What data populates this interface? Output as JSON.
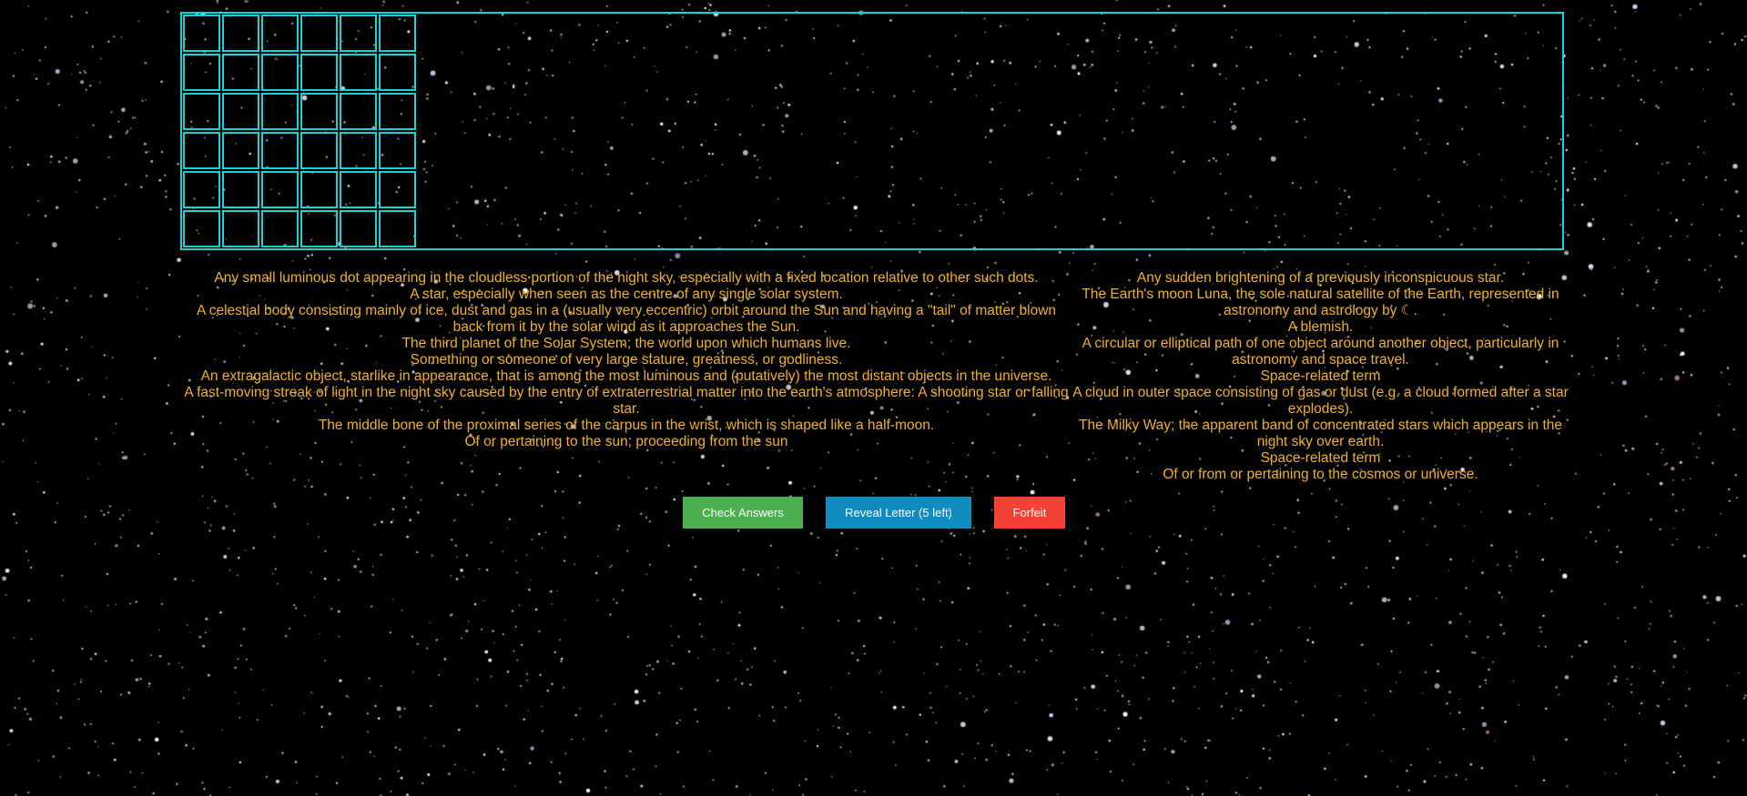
{
  "colors": {
    "background": "#000000",
    "grid_border": "#17d3d3",
    "clue_text": "#f0b020",
    "check_button": "#4caf50",
    "reveal_button": "#0f8bbf",
    "forfeit_button": "#f44336"
  },
  "grid": {
    "rows": 6,
    "cols": 6
  },
  "clues_left": [
    "Any small luminous dot appearing in the cloudless portion of the night sky, especially with a fixed location relative to other such dots.",
    "A star, especially when seen as the centre of any single solar system.",
    "A celestial body consisting mainly of ice, dust and gas in a (usually very eccentric) orbit around the Sun and having a \"tail\" of matter blown back from it by the solar wind as it approaches the Sun.",
    "The third planet of the Solar System; the world upon which humans live.",
    "Something or someone of very large stature, greatness, or godliness.",
    "An extragalactic object, starlike in appearance, that is among the most luminous and (putatively) the most distant objects in the universe.",
    "A fast-moving streak of light in the night sky caused by the entry of extraterrestrial matter into the earth's atmosphere: A shooting star or falling star.",
    "The middle bone of the proximal series of the carpus in the wrist, which is shaped like a half-moon.",
    "Of or pertaining to the sun; proceeding from the sun"
  ],
  "clues_right": [
    "Any sudden brightening of a previously inconspicuous star.",
    "The Earth's moon Luna, the sole natural satellite of the Earth, represented in astronomy and astrology by ☾.",
    "A blemish.",
    "A circular or elliptical path of one object around another object, particularly in astronomy and space travel.",
    "Space-related term",
    "A cloud in outer space consisting of gas or dust (e.g. a cloud formed after a star explodes).",
    "The Milky Way; the apparent band of concentrated stars which appears in the night sky over earth.",
    "Space-related term",
    "Of or from or pertaining to the cosmos or universe."
  ],
  "buttons": {
    "check_label": "Check Answers",
    "reveal_label": "Reveal Letter (5 left)",
    "forfeit_label": "Forfeit"
  }
}
